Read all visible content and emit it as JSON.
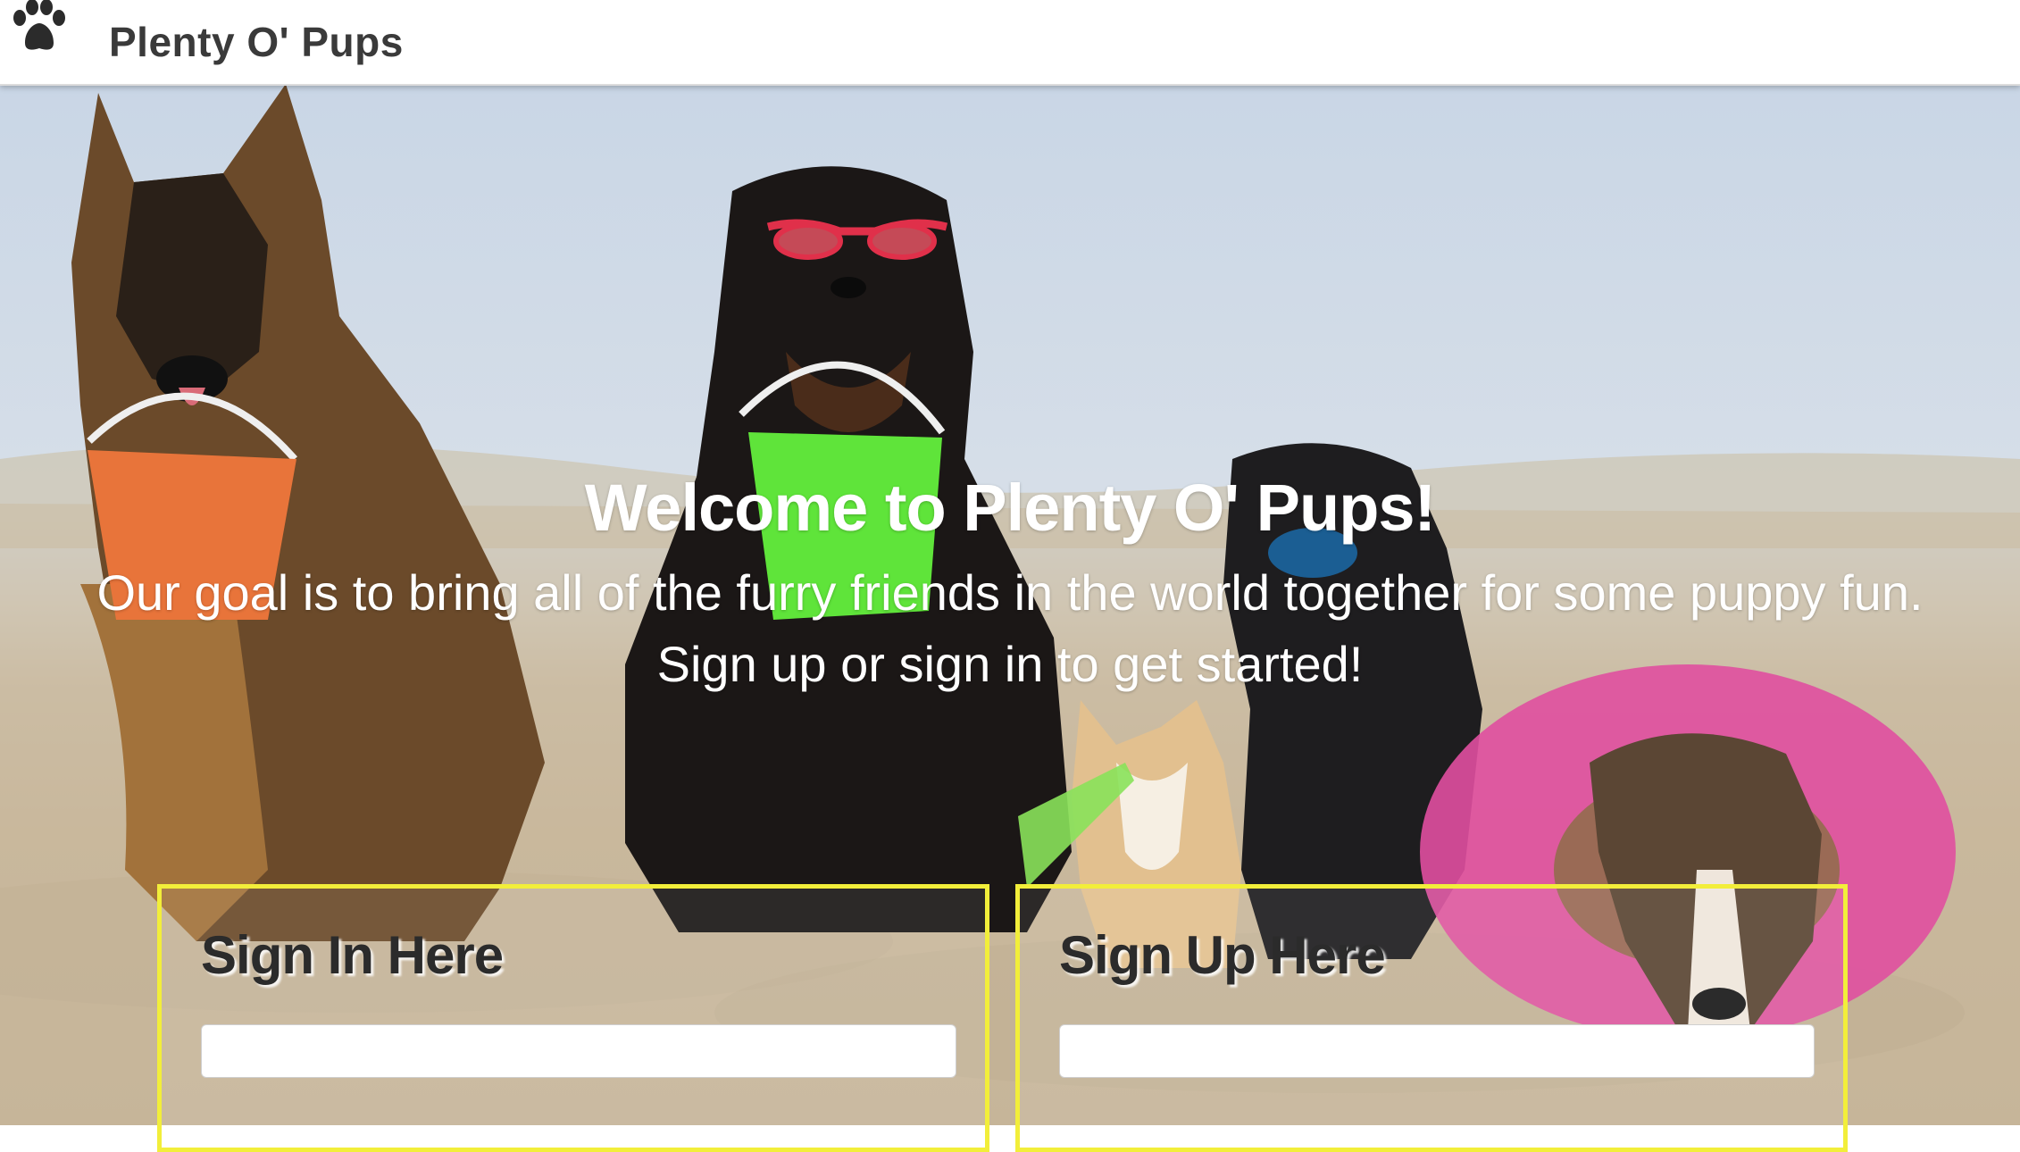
{
  "navbar": {
    "icon": "paw-icon",
    "brand": "Plenty O' Pups"
  },
  "hero": {
    "title": "Welcome to Plenty O' Pups!",
    "subtitle": "Our goal is to bring all of the furry friends in the world together for some puppy fun. Sign up or sign in to get started!",
    "image": "beach-dogs-photo"
  },
  "signin": {
    "title": "Sign In Here",
    "input_placeholder": ""
  },
  "signup": {
    "title": "Sign Up Here",
    "input_placeholder": ""
  },
  "colors": {
    "panel_border": "#f2ee3a",
    "navbar_bg": "#ffffff",
    "brand_text": "#3a3a3a"
  }
}
